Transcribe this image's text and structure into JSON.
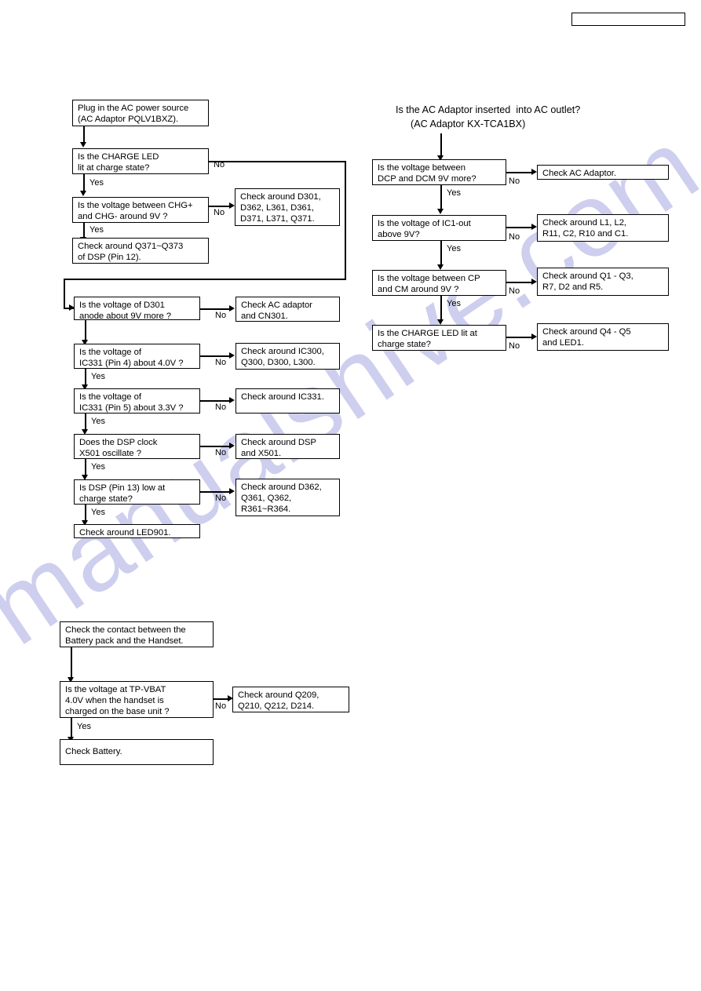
{
  "document": {
    "type": "service-manual-troubleshooting-flowcharts",
    "watermark": "manualshive.com",
    "header_stamp": ""
  },
  "charging_base_flow": {
    "nodes": [
      {
        "id": "n1",
        "text": "Plug in the AC power source\n(AC Adaptor PQLV1BXZ)."
      },
      {
        "id": "n2",
        "text": "Is the CHARGE LED\nlit at charge state?"
      },
      {
        "id": "n3",
        "text": "Is the voltage between CHG+\nand CHG- around 9V ?"
      },
      {
        "id": "n4",
        "text": "Check around Q371~Q373\nof DSP (Pin 12)."
      },
      {
        "id": "n5",
        "text": "Check around D301,\nD362, L361, D361,\nD371, L371, Q371."
      }
    ],
    "labels": {
      "no1": "No",
      "yes1": "Yes",
      "no2": "No",
      "yes2": "Yes"
    }
  },
  "dsp_flow": {
    "questions": [
      {
        "id": "q1",
        "text": "Is the voltage of D301\nanode about 9V more ?"
      },
      {
        "id": "q2",
        "text": "Is the voltage of\nIC331 (Pin 4) about 4.0V ?"
      },
      {
        "id": "q3",
        "text": "Is the voltage of\nIC331 (Pin 5) about 3.3V ?"
      },
      {
        "id": "q4",
        "text": "Does the DSP clock\nX501 oscillate ?"
      },
      {
        "id": "q5",
        "text": "Is DSP (Pin 13) low at\ncharge state?"
      }
    ],
    "actions": [
      {
        "id": "a1",
        "text": "Check AC adaptor\nand CN301."
      },
      {
        "id": "a2",
        "text": "Check around IC300,\nQ300, D300, L300."
      },
      {
        "id": "a3",
        "text": "Check around IC331."
      },
      {
        "id": "a4",
        "text": "Check around DSP\nand X501."
      },
      {
        "id": "a5",
        "text": "Check around D362,\nQ361, Q362,\nR361~R364."
      }
    ],
    "terminal": {
      "id": "t1",
      "text": "Check around LED901."
    },
    "no_label": "No",
    "yes_label": "Yes"
  },
  "ac_adaptor_flow": {
    "title_line1": "Is the AC Adaptor inserted  into AC outlet?",
    "title_line2": "(AC Adaptor KX-TCA1BX)",
    "questions": [
      {
        "id": "rq1",
        "text": "Is the voltage between\nDCP and DCM 9V more?"
      },
      {
        "id": "rq2",
        "text": "Is the voltage of IC1-out\nabove 9V?"
      },
      {
        "id": "rq3",
        "text": "Is the voltage between CP\nand CM around 9V ?"
      },
      {
        "id": "rq4",
        "text": "Is the CHARGE LED lit at\ncharge state?"
      }
    ],
    "actions": [
      {
        "id": "ra1",
        "text": "Check AC Adaptor."
      },
      {
        "id": "ra2",
        "text": "Check around L1, L2,\nR11, C2, R10 and C1."
      },
      {
        "id": "ra3",
        "text": "Check around Q1 - Q3,\nR7, D2 and R5."
      },
      {
        "id": "ra4",
        "text": "Check around Q4 - Q5\nand LED1."
      }
    ],
    "no_label": "No",
    "yes_label": "Yes"
  },
  "battery_flow": {
    "nodes": [
      {
        "id": "b1",
        "text": "Check the contact between the\nBattery pack and the Handset."
      },
      {
        "id": "b2",
        "text": "Is the voltage at TP-VBAT\n4.0V when the handset is\ncharged on the base unit ?"
      },
      {
        "id": "b3",
        "text": "Check around  Q209,\nQ210, Q212, D214."
      },
      {
        "id": "b4",
        "text": "Check Battery."
      }
    ],
    "no_label": "No",
    "yes_label": "Yes"
  },
  "colors": {
    "ink": "#000000",
    "paper": "#ffffff",
    "watermark": "#ccccee"
  }
}
